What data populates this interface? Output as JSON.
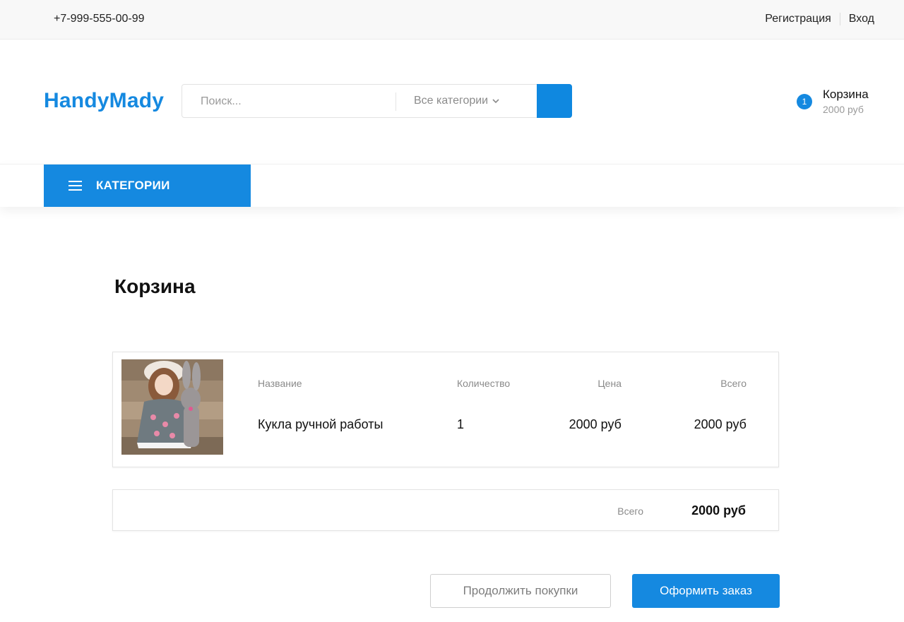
{
  "topbar": {
    "phone": "+7-999-555-00-99",
    "register": "Регистрация",
    "login": "Вход"
  },
  "header": {
    "logo": "HandyMady",
    "search_placeholder": "Поиск...",
    "category_select": "Все категории",
    "cart_count": "1",
    "cart_title": "Корзина",
    "cart_sum": "2000 руб"
  },
  "nav": {
    "categories_label": "КАТЕГОРИИ"
  },
  "page": {
    "title": "Корзина"
  },
  "cart": {
    "headers": {
      "name": "Название",
      "quantity": "Количество",
      "price": "Цена",
      "total": "Всего"
    },
    "items": [
      {
        "name": "Кукла ручной работы",
        "quantity": "1",
        "price": "2000 руб",
        "total": "2000 руб"
      }
    ],
    "summary_label": "Всего",
    "summary_value": "2000 руб"
  },
  "actions": {
    "continue": "Продолжить покупки",
    "checkout": "Оформить заказ"
  },
  "colors": {
    "accent": "#1589e0"
  }
}
